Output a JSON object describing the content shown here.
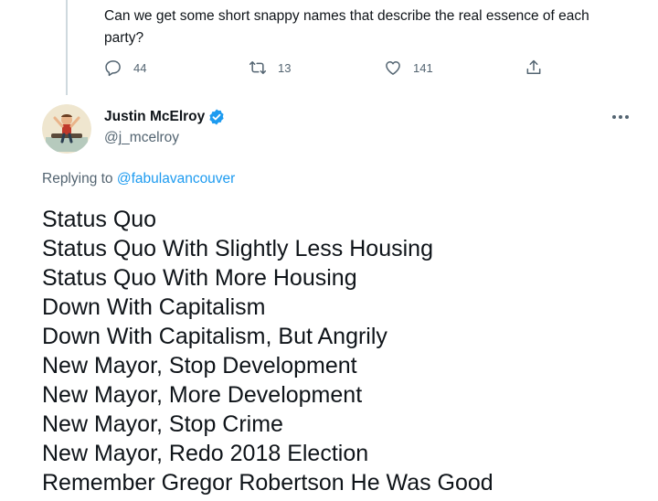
{
  "parent_tweet": {
    "text": "Can we get some short snappy names that describe the real essence of each party?",
    "reply_count": "44",
    "retweet_count": "13",
    "like_count": "141"
  },
  "reply_tweet": {
    "display_name": "Justin McElroy",
    "handle": "@j_mcelroy",
    "replying_prefix": "Replying to",
    "replying_to": "@fabulavancouver",
    "lines": [
      "Status Quo",
      "Status Quo With Slightly Less Housing",
      "Status Quo With More Housing",
      "Down With Capitalism",
      "Down With Capitalism, But Angrily",
      "New Mayor, Stop Development",
      "New Mayor, More Development",
      "New Mayor, Stop Crime",
      "New Mayor, Redo 2018 Election",
      "Remember Gregor Robertson He Was Good"
    ]
  },
  "icons": {
    "reply": "reply-icon",
    "retweet": "retweet-icon",
    "like": "heart-icon",
    "share": "share-icon",
    "verified": "verified-badge-icon",
    "more": "more-options-icon"
  },
  "colors": {
    "text": "#0f1419",
    "secondary": "#536471",
    "accent": "#1d9bf0",
    "thread_line": "#cfd9de"
  }
}
